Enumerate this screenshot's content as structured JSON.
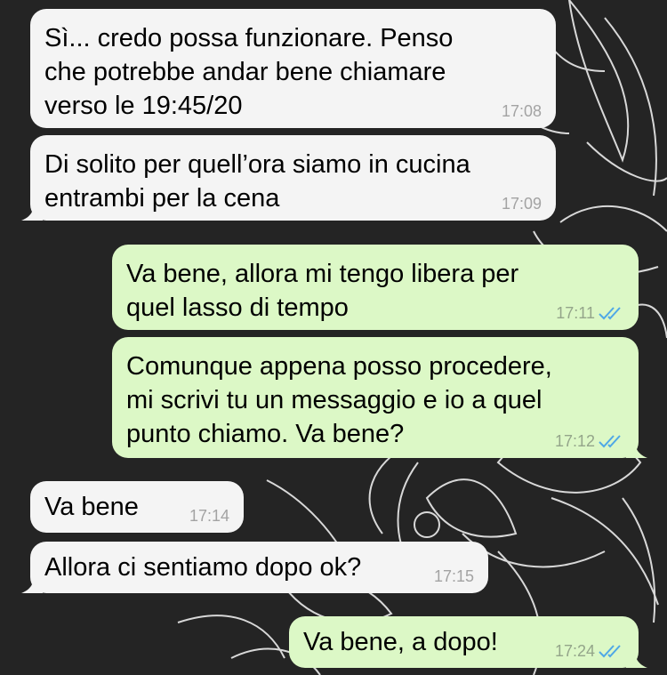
{
  "chat": {
    "background_color": "#242424",
    "incoming_bubble_color": "#f4f4f4",
    "outgoing_bubble_color": "#dcf8c6",
    "read_receipt_color": "#4fa8e6",
    "messages": [
      {
        "direction": "incoming",
        "text": "Sì... credo possa funzionare. Penso\nche potrebbe andar bene chiamare\nverso le 19:45/20",
        "time": "17:08"
      },
      {
        "direction": "incoming",
        "text": "Di solito per quell’ora siamo in cucina\nentrambi per la cena",
        "time": "17:09"
      },
      {
        "direction": "outgoing",
        "text": "Va bene, allora mi tengo libera per\nquel lasso di tempo",
        "time": "17:11",
        "status": "read-double-check-icon"
      },
      {
        "direction": "outgoing",
        "text": "Comunque appena posso procedere,\nmi scrivi tu un messaggio e io a quel\npunto chiamo. Va bene?",
        "time": "17:12",
        "status": "read-double-check-icon"
      },
      {
        "direction": "incoming",
        "text": "Va bene",
        "time": "17:14"
      },
      {
        "direction": "incoming",
        "text": "Allora ci sentiamo dopo ok?",
        "time": "17:15"
      },
      {
        "direction": "outgoing",
        "text": "Va bene, a dopo!",
        "time": "17:24",
        "status": "read-double-check-icon"
      }
    ]
  }
}
